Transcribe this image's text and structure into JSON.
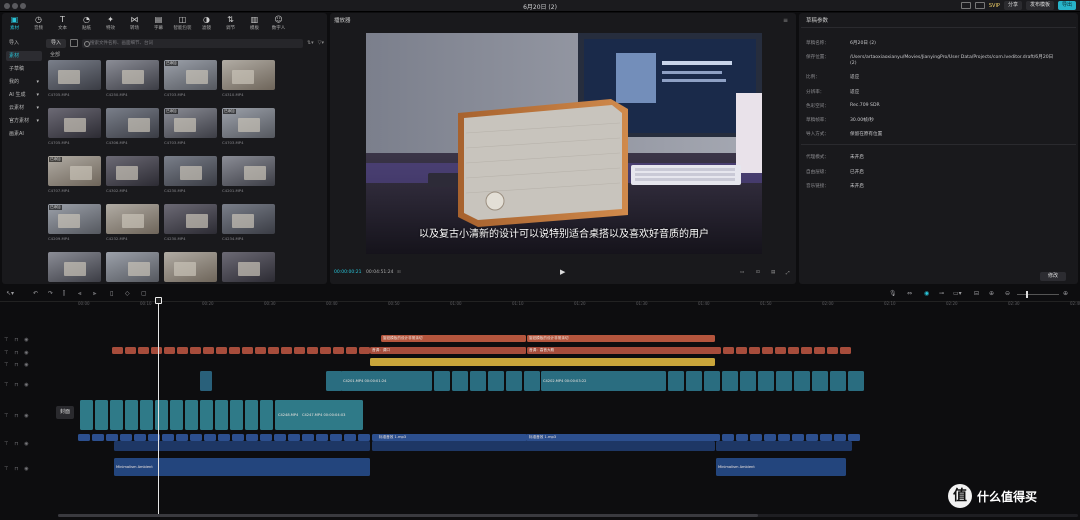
{
  "window": {
    "title": "6月20日 (2)"
  },
  "titlebar": {
    "svip": "SVIP",
    "share": "分享",
    "publish": "发布模板",
    "export": "导出"
  },
  "toolbar": {
    "tools": [
      {
        "label": "素材",
        "icon": "media-icon",
        "glyph": "▣"
      },
      {
        "label": "音频",
        "icon": "audio-icon",
        "glyph": "◷"
      },
      {
        "label": "文本",
        "icon": "text-icon",
        "glyph": "T"
      },
      {
        "label": "贴纸",
        "icon": "sticker-icon",
        "glyph": "◔"
      },
      {
        "label": "特效",
        "icon": "effects-icon",
        "glyph": "✦"
      },
      {
        "label": "转场",
        "icon": "transition-icon",
        "glyph": "⋈"
      },
      {
        "label": "字幕",
        "icon": "caption-icon",
        "glyph": "▤"
      },
      {
        "label": "智能包装",
        "icon": "smart-pack-icon",
        "glyph": "◫"
      },
      {
        "label": "滤镜",
        "icon": "filter-icon",
        "glyph": "◑"
      },
      {
        "label": "调节",
        "icon": "adjust-icon",
        "glyph": "⇅"
      },
      {
        "label": "模板",
        "icon": "template-icon",
        "glyph": "▥"
      },
      {
        "label": "数字人",
        "icon": "avatar-icon",
        "glyph": "☺"
      }
    ]
  },
  "sidenav": {
    "items": [
      "导入",
      "素材",
      "子草稿",
      "我的",
      "AI 生成",
      "云素材",
      "官方素材",
      "画素AI"
    ]
  },
  "media": {
    "import_label": "导入",
    "search_placeholder": "搜索文件名称、画面细节、台词",
    "all_label": "全部",
    "added_badge": "已添加",
    "items": [
      "C4705.MP4",
      "C4250.MP4",
      "C4703.MP4",
      "C4310.MP4",
      "C4705.MP4",
      "C4306.MP4",
      "C4703.MP4",
      "C4703.MP4",
      "C4707.MP4",
      "C4302.MP4",
      "C4230.MP4",
      "C4201.MP4",
      "C4209.MP4",
      "C4232.MP4",
      "C4230.MP4",
      "C4234.MP4",
      "",
      "",
      "",
      ""
    ]
  },
  "player": {
    "title": "播放器",
    "subtitle": "以及复古小清新的设计可以说特别适合桌搭以及喜欢好音质的用户",
    "time_current": "00:00:00:21",
    "time_total": "00:04:51:24"
  },
  "draft": {
    "title": "草稿参数",
    "rows": [
      {
        "k": "草稿名称：",
        "v": "6月20日 (2)"
      },
      {
        "k": "保存位置：",
        "v": "/Users/artaoxiaoxianyu/Movies/JianyingPro/User Data/Projects/com.lveditor.draft/6月20日"
      },
      {
        "k": "",
        "v": "(2)"
      },
      {
        "k": "比例：",
        "v": "适应"
      },
      {
        "k": "分辨率：",
        "v": "适应"
      },
      {
        "k": "色彩空间：",
        "v": "Rec.709 SDR"
      },
      {
        "k": "草稿帧率：",
        "v": "30.00帧/秒"
      },
      {
        "k": "导入方式：",
        "v": "保留在原有位置"
      },
      {
        "k": "代理模式：",
        "v": "未开启"
      },
      {
        "k": "自由层级：",
        "v": "已开启"
      },
      {
        "k": "音乐链接：",
        "v": "未开启"
      }
    ],
    "modify": "修改"
  },
  "timeline": {
    "ruler": [
      "00:00",
      "00:10",
      "00:20",
      "00:30",
      "00:40",
      "00:50",
      "01:00",
      "01:10",
      "01:20",
      "01:30",
      "01:40",
      "01:50",
      "02:00",
      "02:10",
      "02:20",
      "02:30",
      "02:40"
    ],
    "cover": "封面",
    "clip_titles": [
      "旋钮模板的设计非常亲切",
      "旋钮模板的设计非常亲切",
      "音调：调口",
      "音调：高音大概",
      "C4201.MP4  00:00:01:24",
      "C4202.MP4  00:00:03:22",
      "C4248.MP4",
      "C4247.MP4  00:00:04:03",
      "标准音效 1.mp3",
      "标准音效 1.mp3",
      "Minimalism Ambient",
      "Minimalism Ambient"
    ]
  },
  "watermark": {
    "logo": "值",
    "text": "什么值得买"
  }
}
